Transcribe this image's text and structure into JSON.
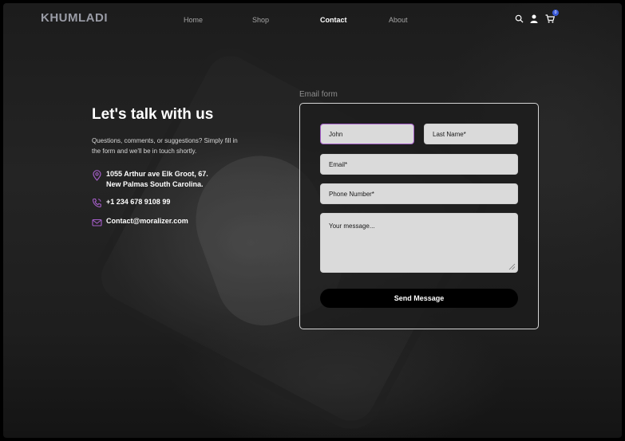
{
  "header": {
    "logo": "KHUMLADI",
    "nav": [
      {
        "label": "Home",
        "active": false
      },
      {
        "label": "Shop",
        "active": false
      },
      {
        "label": "Contact",
        "active": true
      },
      {
        "label": "About",
        "active": false
      }
    ],
    "icons": [
      "search-icon",
      "user-icon",
      "cart-icon"
    ],
    "cart_badge": "0"
  },
  "contact": {
    "heading": "Let's talk with us",
    "lead": "Questions, comments, or suggestions? Simply fill in the form and we'll be in touch shortly.",
    "address_line1": "1055 Arthur ave Elk Groot, 67.",
    "address_line2": "New Palmas South Carolina.",
    "phone": "+1 234 678 9108 99",
    "email": "Contact@moralizer.com"
  },
  "form": {
    "caption": "Email form",
    "first_name_value": "John",
    "last_name_placeholder": "Last Name*",
    "email_placeholder": "Email*",
    "phone_placeholder": "Phone Number*",
    "message_placeholder": "Your message...",
    "submit_label": "Send Message"
  },
  "colors": {
    "accent": "#a45ec7",
    "badge": "#3a5ad8",
    "field_bg": "#dadada",
    "button_bg": "#000000"
  }
}
